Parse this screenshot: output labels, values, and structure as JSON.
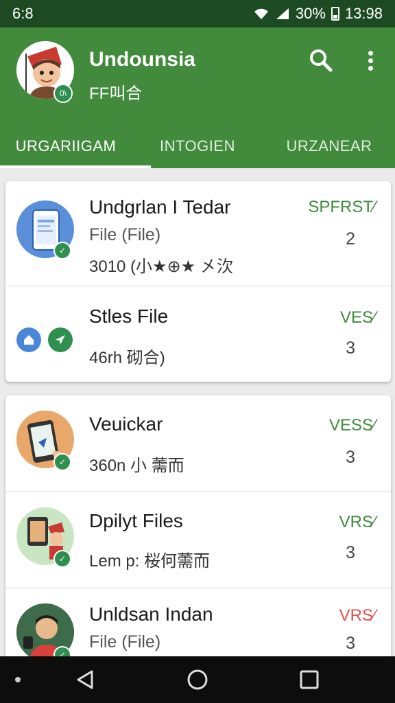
{
  "status_bar": {
    "time": "6:8",
    "battery": "30%",
    "clock": "13:98"
  },
  "app_bar": {
    "title": "Undounsia",
    "subtitle": "FF叫合",
    "profile_badge": "0\\"
  },
  "tabs": [
    {
      "label": "URGARIIGAM",
      "active": true
    },
    {
      "label": "INTOGIEN",
      "active": false
    },
    {
      "label": "URZANEAR",
      "active": false
    }
  ],
  "items": [
    {
      "title": "Undgrlan I Tedar",
      "subtitle": "File (File)",
      "meta": "3010 (小★⊕★ 㐅㳄",
      "status": "SPFRST⁄",
      "count": "2"
    },
    {
      "title": "Stles File",
      "meta": "46rh 砌合)",
      "status": "VES⁄",
      "count": "3"
    },
    {
      "title": "Veuickar",
      "meta": "360n 小 薷而",
      "status": "VESS⁄",
      "count": "3"
    },
    {
      "title": "Dpilyt Files",
      "meta": "Lem p: 桜何薷而",
      "status": "VRS⁄",
      "count": "3"
    },
    {
      "title": "Unldsan Indan",
      "subtitle": "File (File)",
      "status": "VRS⁄",
      "count": "3"
    }
  ],
  "colors": {
    "primary": "#428b3d",
    "status_green": "#3c8c3c",
    "status_red": "#e05050"
  }
}
